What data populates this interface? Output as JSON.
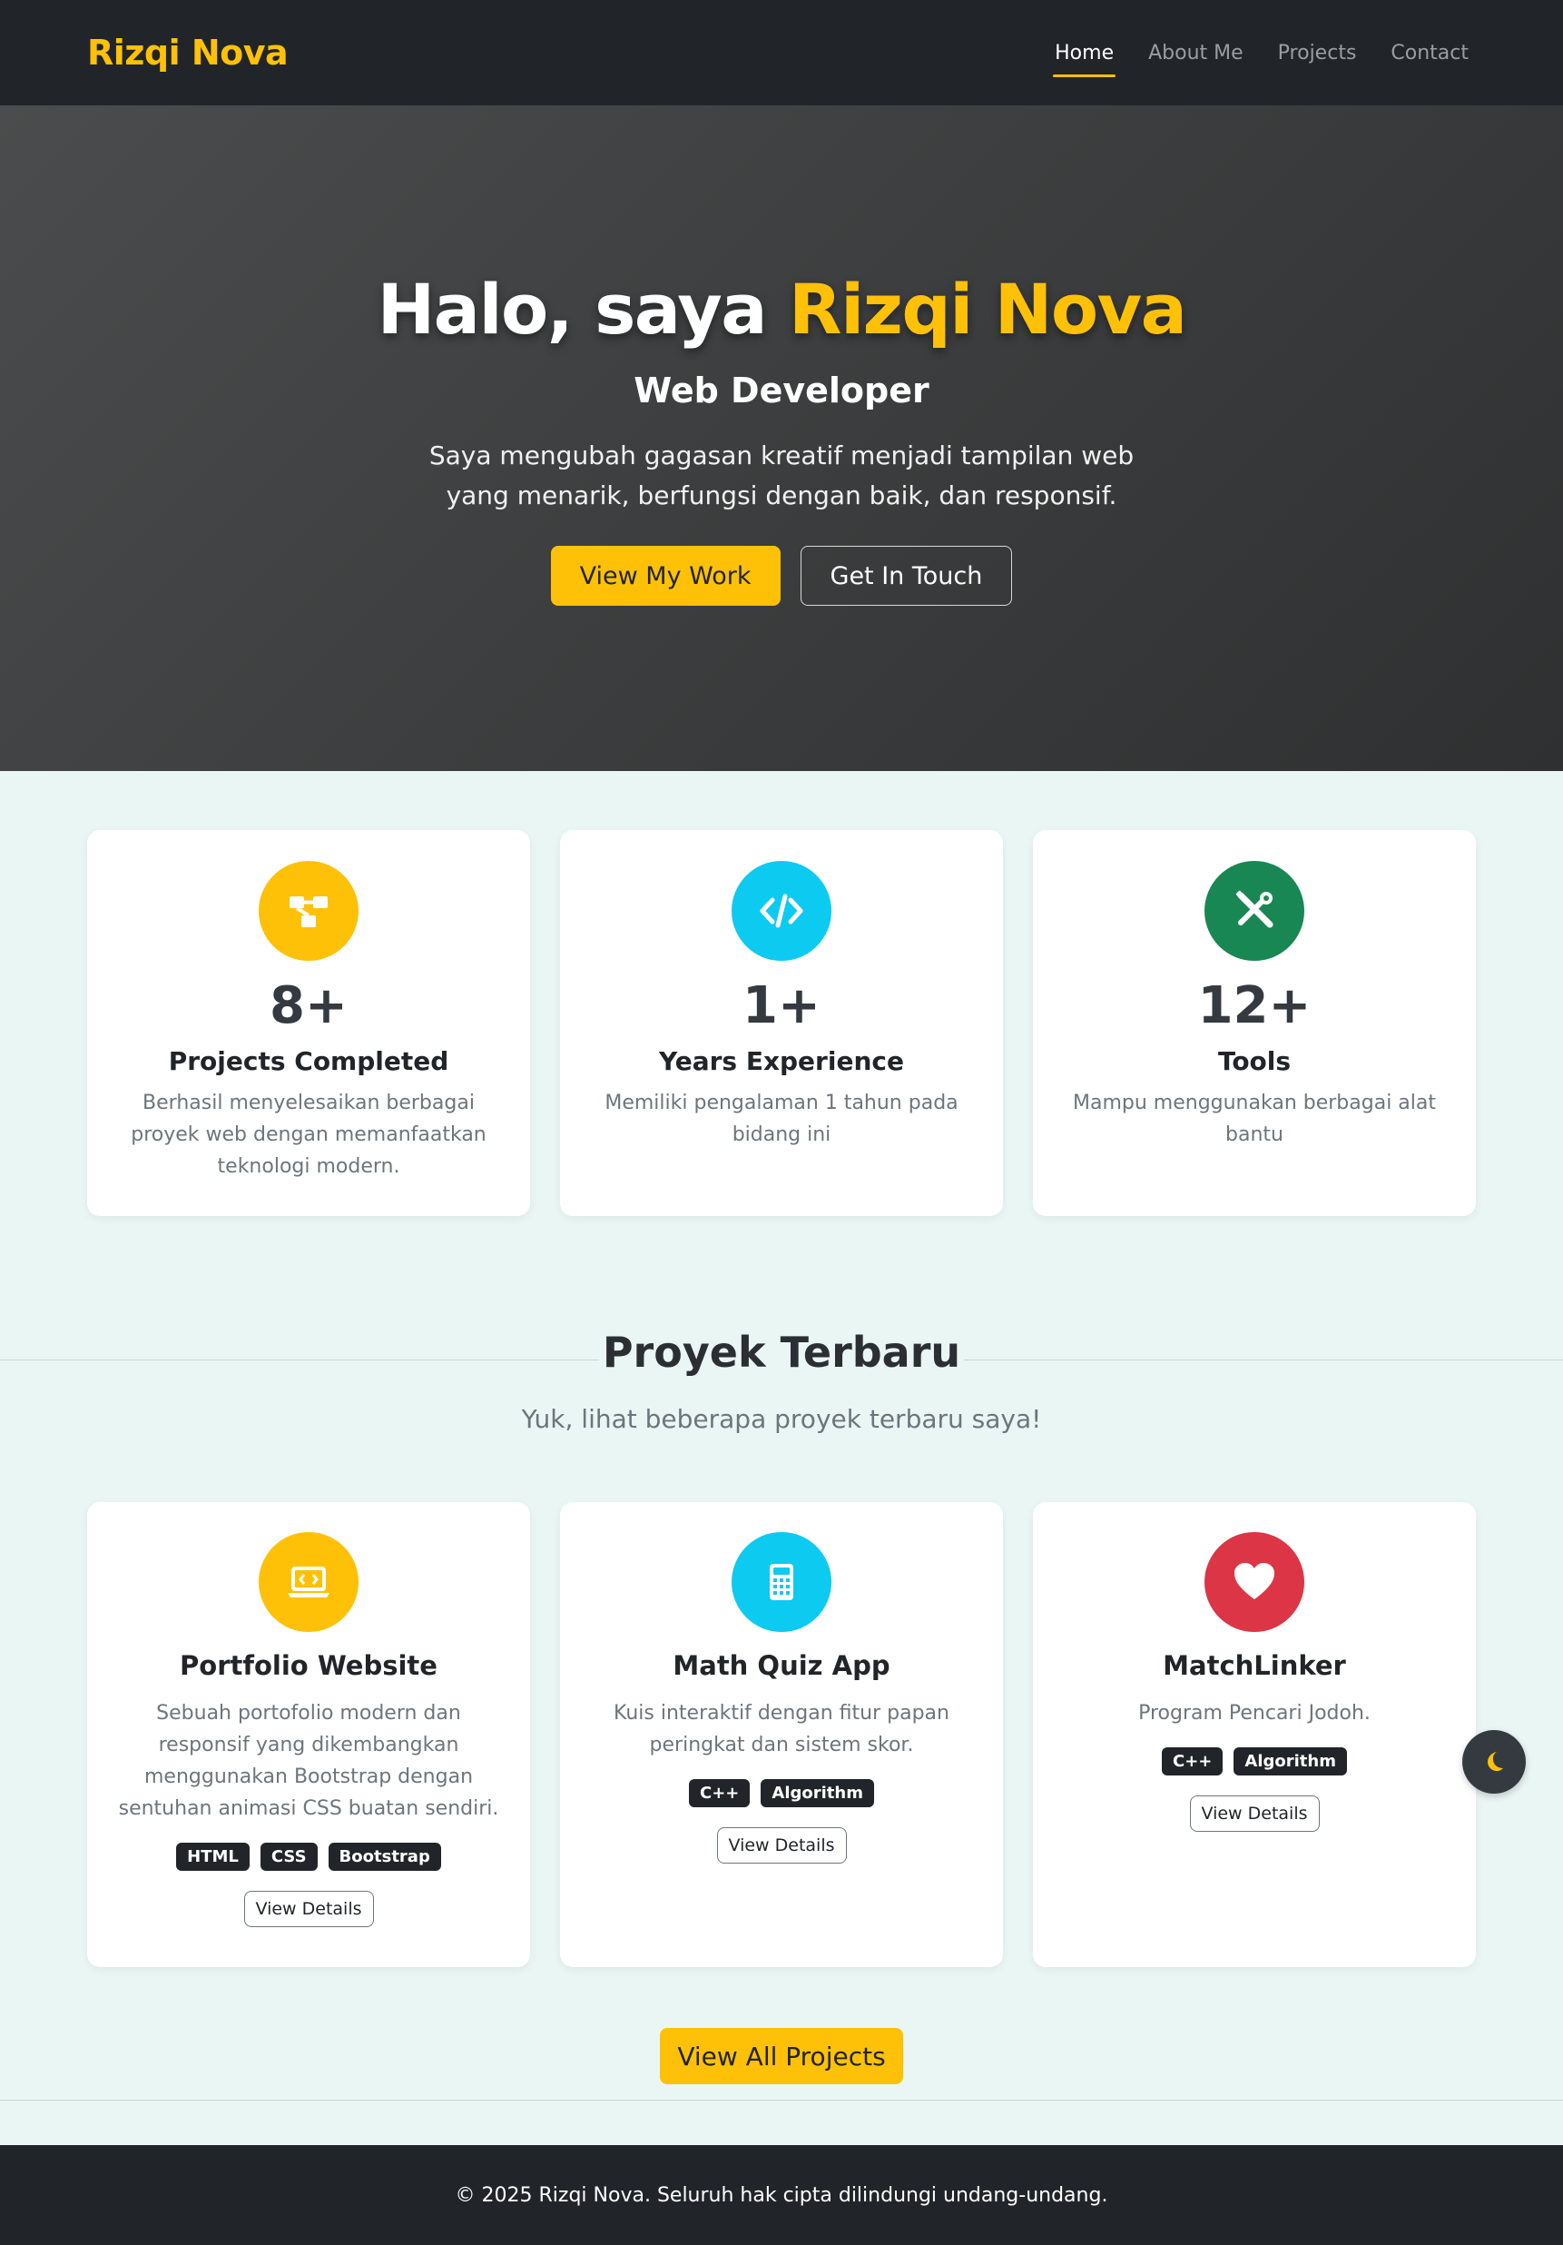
{
  "colors": {
    "accent": "#ffc107",
    "dark": "#212529",
    "info": "#0dcaf0",
    "success": "#198754",
    "danger": "#dc3545"
  },
  "navbar": {
    "brand": "Rizqi Nova",
    "links": [
      {
        "label": "Home",
        "active": true
      },
      {
        "label": "About Me",
        "active": false
      },
      {
        "label": "Projects",
        "active": false
      },
      {
        "label": "Contact",
        "active": false
      }
    ]
  },
  "hero": {
    "greeting": "Halo, saya",
    "name": "Rizqi Nova",
    "role": "Web Developer",
    "tagline": "Saya mengubah gagasan kreatif menjadi tampilan web yang menarik, berfungsi dengan baik, dan responsif.",
    "primary_button": "View My Work",
    "secondary_button": "Get In Touch"
  },
  "stats": [
    {
      "icon": "diagram-icon",
      "color": "#ffc107",
      "value": "8+",
      "title": "Projects Completed",
      "desc": "Berhasil menyelesaikan berbagai proyek web dengan memanfaatkan teknologi modern."
    },
    {
      "icon": "code-icon",
      "color": "#0dcaf0",
      "value": "1+",
      "title": "Years Experience",
      "desc": "Memiliki pengalaman 1 tahun pada bidang ini"
    },
    {
      "icon": "tools-icon",
      "color": "#198754",
      "value": "12+",
      "title": "Tools",
      "desc": "Mampu menggunakan berbagai alat bantu"
    }
  ],
  "projects_section": {
    "title": "Proyek Terbaru",
    "subtitle": "Yuk, lihat beberapa proyek terbaru saya!",
    "view_all": "View All Projects"
  },
  "projects": [
    {
      "icon": "laptop-code-icon",
      "color": "#ffc107",
      "title": "Portfolio Website",
      "desc": "Sebuah portofolio modern dan responsif yang dikembangkan menggunakan Bootstrap dengan sentuhan animasi CSS buatan sendiri.",
      "tags": [
        "HTML",
        "CSS",
        "Bootstrap"
      ],
      "button": "View Details"
    },
    {
      "icon": "calculator-icon",
      "color": "#0dcaf0",
      "title": "Math Quiz App",
      "desc": "Kuis interaktif dengan fitur papan peringkat dan sistem skor.",
      "tags": [
        "C++",
        "Algorithm"
      ],
      "button": "View Details"
    },
    {
      "icon": "heart-icon",
      "color": "#dc3545",
      "title": "MatchLinker",
      "desc": "Program Pencari Jodoh.",
      "tags": [
        "C++",
        "Algorithm"
      ],
      "button": "View Details"
    }
  ],
  "theme_toggle": {
    "icon": "moon-icon"
  },
  "footer": {
    "text": "© 2025 Rizqi Nova. Seluruh hak cipta dilindungi undang-undang."
  }
}
